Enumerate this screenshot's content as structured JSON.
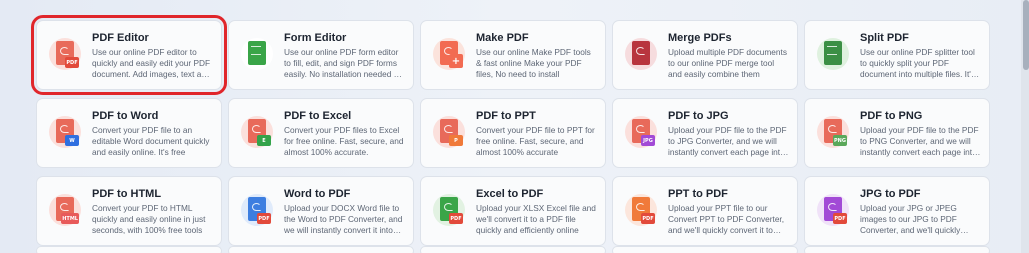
{
  "tools": [
    {
      "title": "PDF Editor",
      "desc": "Use our online PDF editor to quickly and easily edit your PDF document. Add images, text and more",
      "icon": "pdf-editor-icon",
      "bg": "#fbe0dc",
      "doc": "#e86a5a",
      "badge": "PDF",
      "badgeColor": "#e24a3b",
      "selected": true
    },
    {
      "title": "Form Editor",
      "desc": "Use our online PDF form editor to fill, edit, and sign PDF forms easily. No installation needed at all",
      "icon": "form-editor-icon",
      "bg": "#ffffff",
      "doc": "#3aa548",
      "badge": "",
      "badgeColor": "#3aa548"
    },
    {
      "title": "Make PDF",
      "desc": "Use our online Make PDF tools & fast online Make your PDF files, No need to install",
      "icon": "make-pdf-icon",
      "bg": "#fbe3dc",
      "doc": "#f26b52",
      "badge": "+",
      "badgeColor": "#f26b52"
    },
    {
      "title": "Merge PDFs",
      "desc": "Upload multiple PDF documents to our online PDF merge tool and easily combine them",
      "icon": "merge-pdf-icon",
      "bg": "#f6dcde",
      "doc": "#b8353e",
      "badge": "",
      "badgeColor": "#e24a3b"
    },
    {
      "title": "Split PDF",
      "desc": "Use our online PDF splitter tool to quickly split your PDF document into multiple files. It's easy",
      "icon": "split-pdf-icon",
      "bg": "#dff1df",
      "doc": "#3b8f45",
      "badge": "",
      "badgeColor": "#e24a3b"
    },
    {
      "title": "PDF to Word",
      "desc": "Convert your PDF file to an editable Word document quickly and easily online. It's free",
      "icon": "pdf-to-word-icon",
      "bg": "#fbe0dc",
      "doc": "#e86a5a",
      "badge": "W",
      "badgeColor": "#2f6fe0"
    },
    {
      "title": "PDF to Excel",
      "desc": "Convert your PDF files to Excel for free online. Fast, secure, and almost 100% accurate.",
      "icon": "pdf-to-excel-icon",
      "bg": "#fbe0dc",
      "doc": "#e86a5a",
      "badge": "E",
      "badgeColor": "#34a34a"
    },
    {
      "title": "PDF to PPT",
      "desc": "Convert your PDF file to PPT for free online. Fast, secure, and almost 100% accurate",
      "icon": "pdf-to-ppt-icon",
      "bg": "#fbe0dc",
      "doc": "#e86a5a",
      "badge": "P",
      "badgeColor": "#f07a3a"
    },
    {
      "title": "PDF to JPG",
      "desc": "Upload your PDF file to the PDF to JPG Converter, and we will instantly convert each page into JPG",
      "icon": "pdf-to-jpg-icon",
      "bg": "#fbe0dc",
      "doc": "#e86a5a",
      "badge": "JPG",
      "badgeColor": "#a24ad6"
    },
    {
      "title": "PDF to PNG",
      "desc": "Upload your PDF file to the PDF to PNG Converter, and we will instantly convert each page into PNG",
      "icon": "pdf-to-png-icon",
      "bg": "#fbe0dc",
      "doc": "#e86a5a",
      "badge": "PNG",
      "badgeColor": "#5aa85a"
    },
    {
      "title": "PDF to HTML",
      "desc": "Convert your PDF to HTML quickly and easily online in just seconds, with 100% free tools",
      "icon": "pdf-to-html-icon",
      "bg": "#fbe0dc",
      "doc": "#e86a5a",
      "badge": "HTML",
      "badgeColor": "#e85a5a"
    },
    {
      "title": "Word to PDF",
      "desc": "Upload your DOCX Word file to the Word to PDF Converter, and we will instantly convert it into PDF",
      "icon": "word-to-pdf-icon",
      "bg": "#e0ebfb",
      "doc": "#3d7ee0",
      "badge": "PDF",
      "badgeColor": "#e24a3b"
    },
    {
      "title": "Excel to PDF",
      "desc": "Upload your XLSX Excel file and we'll convert it to a PDF file quickly and efficiently online",
      "icon": "excel-to-pdf-icon",
      "bg": "#e2f2e2",
      "doc": "#3aa548",
      "badge": "PDF",
      "badgeColor": "#e24a3b"
    },
    {
      "title": "PPT to PDF",
      "desc": "Upload your PPT file to our Convert PPT to PDF Converter, and we'll quickly convert it to PDF",
      "icon": "ppt-to-pdf-icon",
      "bg": "#fce6dc",
      "doc": "#f07a3a",
      "badge": "PDF",
      "badgeColor": "#e24a3b"
    },
    {
      "title": "JPG to PDF",
      "desc": "Upload your JPG or JPEG images to our JPG to PDF Converter, and we'll quickly convert them",
      "icon": "jpg-to-pdf-icon",
      "bg": "#f0e2f8",
      "doc": "#a24ad6",
      "badge": "PDF",
      "badgeColor": "#e24a3b"
    }
  ]
}
